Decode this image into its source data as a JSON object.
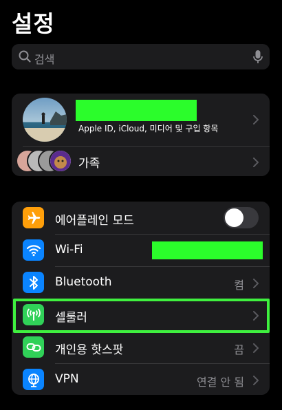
{
  "header": {
    "title": "설정"
  },
  "search": {
    "placeholder": "검색"
  },
  "account": {
    "subtitle": "Apple ID, iCloud, 미디어 및 구입 항목",
    "family_label": "가족",
    "family_members": 4
  },
  "settings": {
    "airplane": {
      "label": "에어플레인 모드",
      "enabled": false
    },
    "wifi": {
      "label": "Wi-Fi"
    },
    "bluetooth": {
      "label": "Bluetooth",
      "value": "켬"
    },
    "cellular": {
      "label": "셀룰러"
    },
    "hotspot": {
      "label": "개인용 핫스팟",
      "value": "끔"
    },
    "vpn": {
      "label": "VPN",
      "value": "연결 안 됨"
    }
  },
  "colors": {
    "background": "#000000",
    "group": "#1c1c1e",
    "secondary_text": "#8e8e93",
    "airplane": "#ff9f0a",
    "wifi": "#0a84ff",
    "bluetooth": "#0a84ff",
    "cellular": "#30d158",
    "hotspot": "#30d158",
    "vpn": "#0a84ff",
    "redaction": "#2bfd2b",
    "highlight": "#3ff03f"
  }
}
